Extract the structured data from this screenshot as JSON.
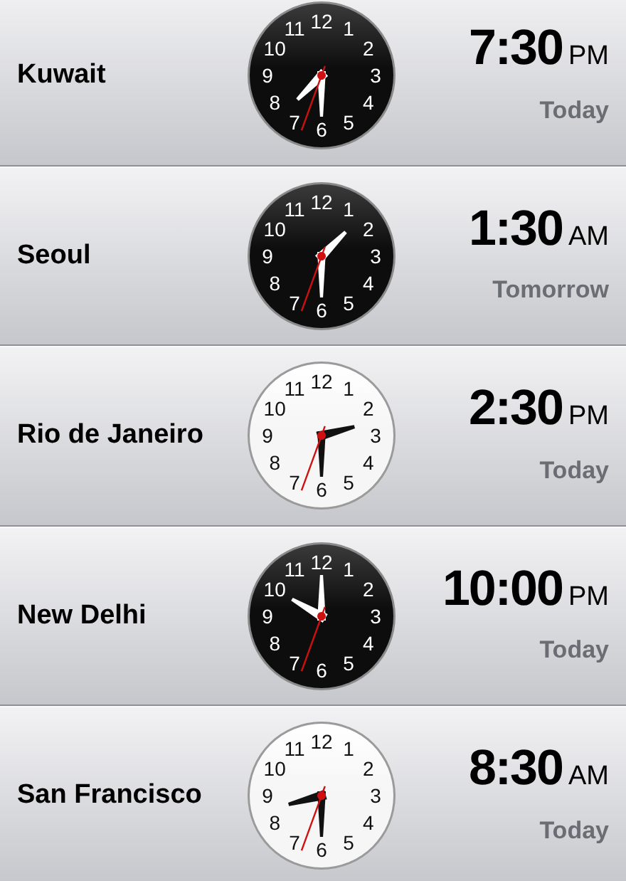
{
  "cities": [
    {
      "name": "Kuwait",
      "time": "7:30",
      "meridiem": "PM",
      "day": "Today",
      "kind": "night",
      "dial": [
        "11",
        "12",
        "1",
        "10",
        "2",
        "9",
        "3",
        "8",
        "4",
        "7",
        "6",
        "5"
      ]
    },
    {
      "name": "Seoul",
      "time": "1:30",
      "meridiem": "AM",
      "day": "Tomorrow",
      "kind": "night",
      "dial": [
        "11",
        "12",
        "1",
        "10",
        "2",
        "9",
        "3",
        "8",
        "4",
        "7",
        "6",
        "5"
      ]
    },
    {
      "name": "Rio de Janeiro",
      "time": "2:30",
      "meridiem": "PM",
      "day": "Today",
      "kind": "day",
      "dial": [
        "11",
        "12",
        "1",
        "10",
        "2",
        "9",
        "3",
        "8",
        "4",
        "7",
        "6",
        "5"
      ]
    },
    {
      "name": "New Delhi",
      "time": "10:00",
      "meridiem": "PM",
      "day": "Today",
      "kind": "night",
      "dial": [
        "11",
        "12",
        "1",
        "10",
        "2",
        "9",
        "3",
        "8",
        "4",
        "7",
        "6",
        "5"
      ]
    },
    {
      "name": "San Francisco",
      "time": "8:30",
      "meridiem": "AM",
      "day": "Today",
      "kind": "day",
      "dial": [
        "11",
        "12",
        "1",
        "10",
        "2",
        "9",
        "3",
        "8",
        "4",
        "7",
        "6",
        "5"
      ]
    }
  ]
}
